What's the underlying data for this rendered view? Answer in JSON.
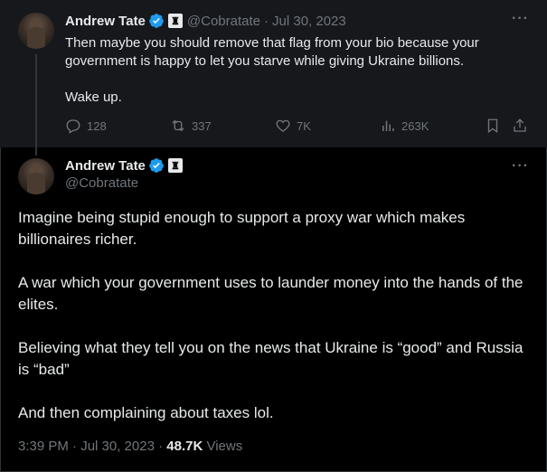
{
  "parent_tweet": {
    "author_name": "Andrew Tate",
    "badge_glyph": "♜",
    "handle": "@Cobratate",
    "separator": "·",
    "date": "Jul 30, 2023",
    "more_glyph": "···",
    "paragraphs": [
      "Then maybe you should remove that flag from your bio because your government is happy to let you starve while giving Ukraine billions.",
      "Wake up."
    ],
    "actions": {
      "replies": "128",
      "reposts": "337",
      "likes": "7K",
      "views": "263K"
    }
  },
  "main_tweet": {
    "author_name": "Andrew Tate",
    "badge_glyph": "♜",
    "handle": "@Cobratate",
    "more_glyph": "···",
    "paragraphs": [
      "Imagine being stupid enough to support a proxy war which makes billionaires richer.",
      "A war which your government uses to launder money into the hands of the elites.",
      "Believing what they tell you on the news that Ukraine is “good” and Russia is “bad”",
      "And then complaining about taxes lol."
    ],
    "timestamp": "3:39 PM · Jul 30, 2023 ·",
    "views_count": "48.7K",
    "views_label": "Views"
  },
  "colors": {
    "background": "#000000",
    "parent_background": "#16181c",
    "text": "#e7e9ea",
    "muted": "#71767b",
    "verified_blue": "#1d9bf0"
  }
}
